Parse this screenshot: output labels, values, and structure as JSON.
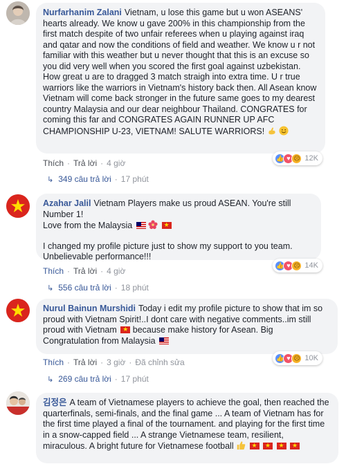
{
  "comments": [
    {
      "author": "Nurfarhanim Zalani",
      "text": "Vietnam, u lose this game but u won ASEANS' hearts already. We know u gave 200% in this championship from the first match despite of two unfair referees when u playing against iraq and qatar and now the conditions of field and weather. We know u r not familiar with this weather but u never thought that this is an excuse so you did very well when you scored the first goal against uzbekistan. How great u are to dragged 3 match straigh into extra time. U r true warriors like the warriors in Vietnam's history back then. All Asean know Vietnam will come back stronger in the future same goes to my dearest country Malaysia and our dear neighbour Thailand. CONGRATES for coming this far and CONGRATES AGAIN RUNNER UP AFC CHAMPIONSHIP U-23, VIETNAM! SALUTE WARRIORS!",
      "emoji": [
        "flexed-biceps-icon",
        "smiling-face-icon"
      ],
      "like_label": "Thích",
      "reply_label": "Trả lời",
      "time": "4 giờ",
      "reaction_count": "12K",
      "replies_label": "349 câu trả lời",
      "replies_time": "17 phút"
    },
    {
      "author": "Azahar Jalil",
      "text1": "Vietnam Players make us proud ASEAN. You're still Number 1!",
      "text2": "Love from the Malaysia",
      "text3": "I changed my profile picture just to show my support to you team. Unbelievable performance!!!",
      "like_label": "Thích",
      "reply_label": "Trả lời",
      "time": "4 giờ",
      "reaction_count": "14K",
      "replies_label": "556 câu trả lời",
      "replies_time": "18 phút"
    },
    {
      "author": "Nurul Bainun Murshidi",
      "text1": "Today i edit my profile picture to show that im so proud with Vietnam Spirit!..I dont care with negative comments..im still proud with Vietnam",
      "text2": "because make history for Asean. Big Congratulation from Malaysia",
      "like_label": "Thích",
      "reply_label": "Trả lời",
      "time": "3 giờ",
      "edited_label": "Đã chỉnh sửa",
      "reaction_count": "10K",
      "replies_label": "269 câu trả lời",
      "replies_time": "17 phút"
    },
    {
      "author": "김정은",
      "text": "A team of Vietnamese players to achieve the goal, then reached the quarterfinals, semi-finals, and the final game ... A team of Vietnam has for the first time played a final of the tournament. and playing for the first time in a snow-capped field ... A strange Vietnamese team, resilient, miraculous. A bright future for Vietnamese football"
    }
  ],
  "colors": {
    "link_blue": "#385898",
    "bubble_bg": "#f2f3f5",
    "meta_gray": "#90949c",
    "vietnam_red": "#da251d",
    "vietnam_star": "#ffde00"
  }
}
